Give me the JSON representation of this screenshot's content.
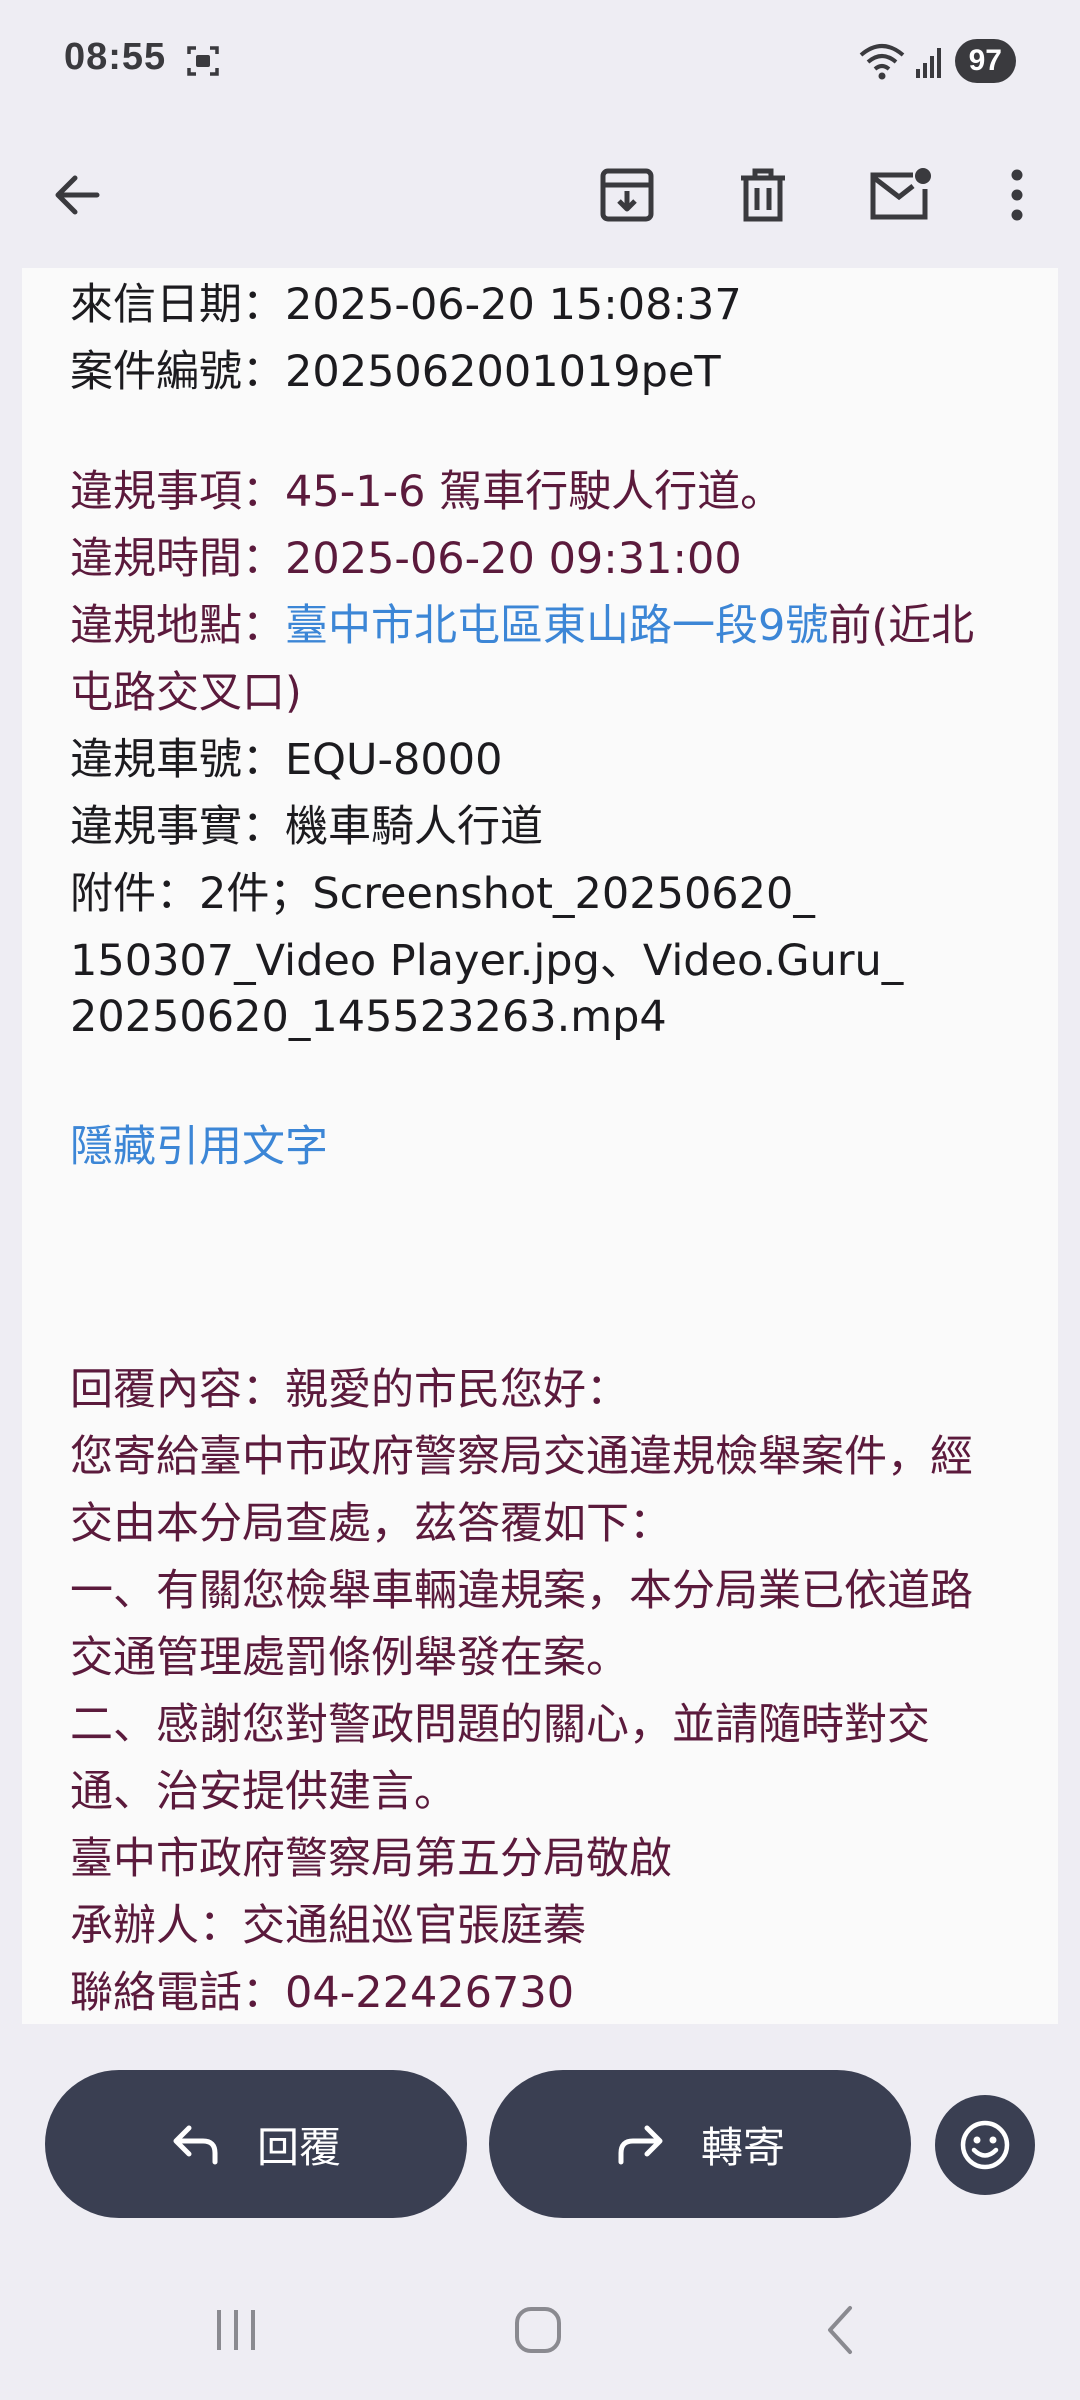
{
  "status_bar": {
    "time": "08:55",
    "battery": "97",
    "icons": [
      "screenshot-icon",
      "wifi-icon",
      "signal-icon"
    ]
  },
  "toolbar": {
    "icons": [
      "back-arrow-icon",
      "archive-icon",
      "delete-icon",
      "mark-unread-icon",
      "more-vert-icon"
    ]
  },
  "email": {
    "received_date_label": "來信日期：",
    "received_date": "2025-06-20 15:08:37",
    "case_no_label": "案件編號：",
    "case_no": "2025062001019peT",
    "violation_item_label": "違規事項：",
    "violation_item": "45-1-6 駕車行駛人行道。",
    "violation_time_label": "違規時間：",
    "violation_time": "2025-06-20 09:31:00",
    "violation_place_label": "違規地點：",
    "violation_place_link": "臺中市北屯區東山路一段9號",
    "violation_place_rest": "前(近北",
    "violation_place_line2": "屯路交叉口)",
    "plate_label": "違規車號：",
    "plate": "EQU-8000",
    "fact_label": "違規事實：",
    "fact": "機車騎人行道",
    "attachment_line1": "附件：2件；Screenshot_20250620_",
    "attachment_line2": "150307_Video Player.jpg、Video.Guru_",
    "attachment_line3": "20250620_145523263.mp4",
    "hide_quoted": "隱藏引用文字",
    "reply_lines": [
      "回覆內容：親愛的市民您好：",
      "您寄給臺中市政府警察局交通違規檢舉案件，經",
      "交由本分局查處，茲答覆如下：",
      "一、有關您檢舉車輛違規案，本分局業已依道路",
      "交通管理處罰條例舉發在案。",
      "二、感謝您對警政問題的關心，並請隨時對交",
      "通、治安提供建言。",
      "臺中市政府警察局第五分局敬啟",
      "承辦人：交通組巡官張庭蓁",
      "聯絡電話：04-22426730"
    ]
  },
  "actions": {
    "reply_label": "回覆",
    "forward_label": "轉寄"
  },
  "colors": {
    "maroon_text": "#5b1a3c",
    "link": "#3c86d6",
    "button_bg": "#3a3f52",
    "background": "#eeedf3"
  }
}
